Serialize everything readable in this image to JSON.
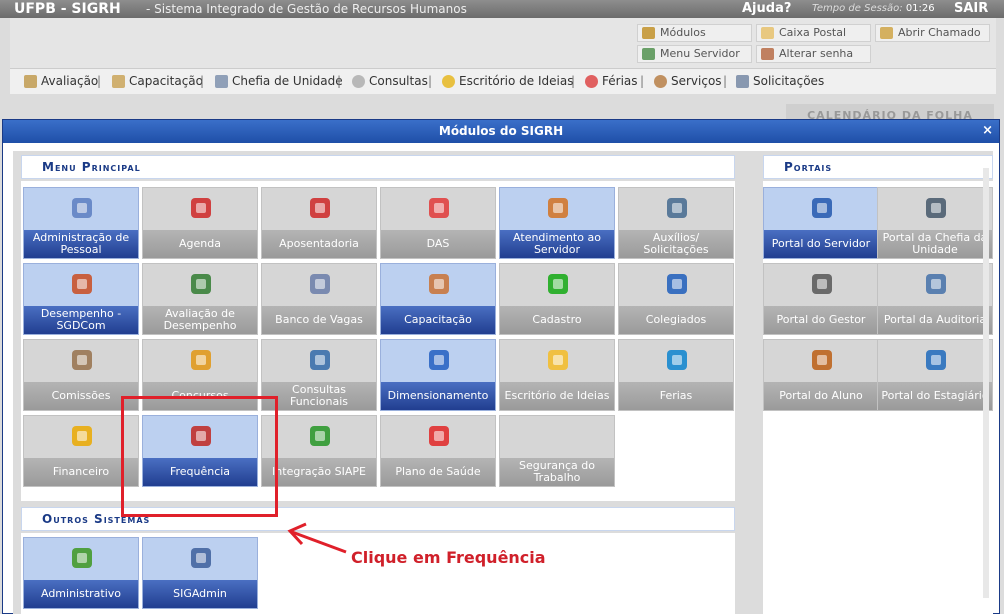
{
  "top": {
    "brand": "UFPB - SIGRH",
    "subtitle": "- Sistema Integrado de Gestão de Recursos Humanos",
    "help": "Ajuda?",
    "session_label": "Tempo de Sessão:",
    "session_time": "01:26",
    "sair": "SAIR"
  },
  "header_buttons": {
    "modulos": "Módulos",
    "caixa": "Caixa Postal",
    "chamado": "Abrir Chamado",
    "menu_servidor": "Menu Servidor",
    "senha": "Alterar senha"
  },
  "menubar": [
    "Avaliação",
    "Capacitação",
    "Chefia de Unidade",
    "Consultas",
    "Escritório de Ideias",
    "Férias",
    "Serviços",
    "Solicitações"
  ],
  "bg_tab": "CALENDÁRIO DA FOLHA",
  "modal": {
    "title": "Módulos do SIGRH",
    "close": "×"
  },
  "sections": {
    "main": "Menu Principal",
    "portals": "Portais",
    "others": "Outros Sistemas"
  },
  "main_tiles": [
    {
      "label": "Administração de Pessoal",
      "icon": "monitor-pessoal-icon",
      "active": true
    },
    {
      "label": "Agenda",
      "icon": "calendar-icon",
      "active": false
    },
    {
      "label": "Aposentadoria",
      "icon": "calendar-check-icon",
      "active": false
    },
    {
      "label": "DAS",
      "icon": "das-icon",
      "active": false
    },
    {
      "label": "Atendimento ao Servidor",
      "icon": "headset-person-icon",
      "active": true
    },
    {
      "label": "Auxílios/ Solicitações",
      "icon": "computer-icon",
      "active": false
    },
    {
      "label": "Desempenho - SGDCom",
      "icon": "people-icon",
      "active": true
    },
    {
      "label": "Avaliação de Desempenho",
      "icon": "people-check-icon",
      "active": false
    },
    {
      "label": "Banco de Vagas",
      "icon": "database-icon",
      "active": false
    },
    {
      "label": "Capacitação",
      "icon": "people-group-icon",
      "active": true
    },
    {
      "label": "Cadastro",
      "icon": "plus-icon",
      "active": false
    },
    {
      "label": "Colegiados",
      "icon": "globe-icon",
      "active": false
    },
    {
      "label": "Comissões",
      "icon": "group-icon",
      "active": false
    },
    {
      "label": "Concursos",
      "icon": "pencil-paper-icon",
      "active": false
    },
    {
      "label": "Consultas Funcionais",
      "icon": "magnifier-icon",
      "active": false
    },
    {
      "label": "Dimensionamento",
      "icon": "cubes-icon",
      "active": true
    },
    {
      "label": "Escritório de Ideias",
      "icon": "lightbulb-icon",
      "active": false
    },
    {
      "label": "Ferias",
      "icon": "airplane-icon",
      "active": false
    },
    {
      "label": "Financeiro",
      "icon": "dollar-coin-icon",
      "active": false
    },
    {
      "label": "Frequência",
      "icon": "checklist-icon",
      "active": true
    },
    {
      "label": "Integração SIAPE",
      "icon": "arrows-cubes-icon",
      "active": false
    },
    {
      "label": "Plano de Saúde",
      "icon": "medical-cross-icon",
      "active": false
    },
    {
      "label": "Segurança do Trabalho",
      "icon": "",
      "active": false
    }
  ],
  "portal_tiles": [
    {
      "label": "Portal do Servidor",
      "icon": "person-blue-icon",
      "active": true
    },
    {
      "label": "Portal da Chefia da Unidade",
      "icon": "person-suit-icon",
      "active": false
    },
    {
      "label": "Portal do Gestor",
      "icon": "person-gray-icon",
      "active": false
    },
    {
      "label": "Portal da Auditoria",
      "icon": "person-search-icon",
      "active": false
    },
    {
      "label": "Portal do Aluno",
      "icon": "person-student-icon",
      "active": false
    },
    {
      "label": "Portal do Estagiário",
      "icon": "person-intern-icon",
      "active": false
    }
  ],
  "other_tiles": [
    {
      "label": "Administrativo",
      "icon": "admin-arrows-icon",
      "active": true
    },
    {
      "label": "SIGAdmin",
      "icon": "admin-computer-icon",
      "active": true
    }
  ],
  "annotation": "Clique em Frequência",
  "colors": {
    "accent": "#2a4fa6",
    "annotation": "#d0202a"
  }
}
